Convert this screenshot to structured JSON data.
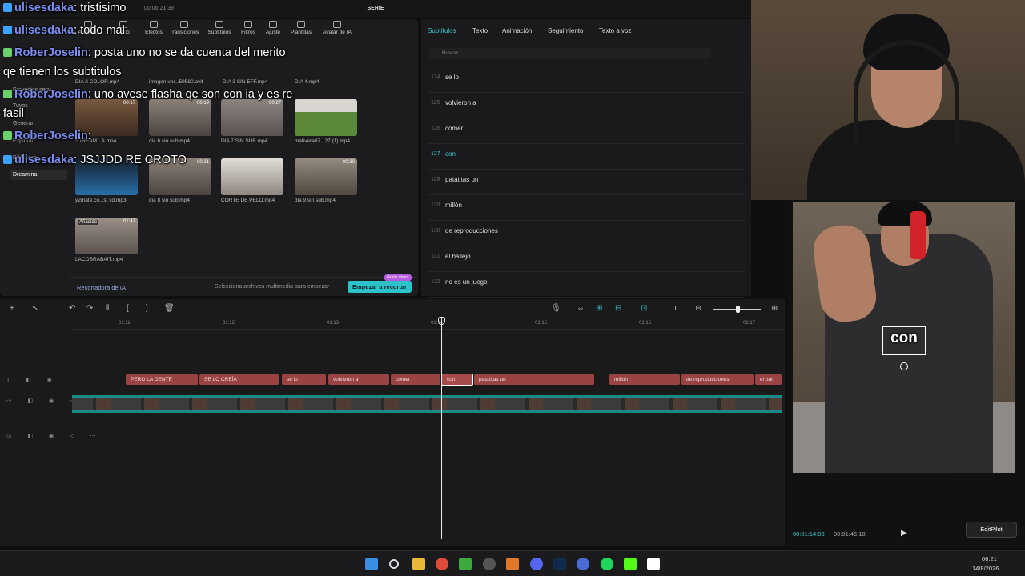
{
  "app": {
    "title": "SERIE",
    "timecode": "00:06:21:39"
  },
  "chat": [
    {
      "user": "ulisesdaka",
      "msg": ": tristisimo"
    },
    {
      "user": "ulisesdaka",
      "msg": ": todo mal"
    },
    {
      "user": "RoberJoselin",
      "msg": ": posta uno no se da cuenta del merito"
    },
    {
      "user": "",
      "msg": "qe tienen los subtitulos"
    },
    {
      "user": "RoberJoselin",
      "msg": ": uno avese flasha qe son con ia y es re"
    },
    {
      "user": "",
      "msg": "fasil"
    },
    {
      "user": "RoberJoselin",
      "msg": ":"
    },
    {
      "user": "ulisesdaka",
      "msg": ": JSJJDD RE CROTO"
    }
  ],
  "toolbar": [
    "Archivos",
    "Texto",
    "Efectos",
    "Transiciones",
    "Subtítulos",
    "Filtros",
    "Ajuste",
    "Plantillas",
    "Avatar de IA"
  ],
  "side_nav": [
    "Proyectos secu...",
    "Tuyos",
    "Generar",
    "Explorar",
    "Biblioteca",
    "Dreamina"
  ],
  "media": [
    {
      "name": "DIA 2 COLOR.mp4",
      "dur": ""
    },
    {
      "name": "imagen-ver...59580.avif",
      "dur": ""
    },
    {
      "name": "DIA 3 SIN EFF.mp4",
      "dur": ""
    },
    {
      "name": "DIA 4.mp4",
      "dur": ""
    },
    {
      "name": "STREAM...A.mp4",
      "dur": "00:17"
    },
    {
      "name": "dia 6 sin sub.mp4",
      "dur": "00:19"
    },
    {
      "name": "DIA 7 SIN SUB.mp4",
      "dur": "00:27"
    },
    {
      "name": "mativera07...27 (1).mp4",
      "dur": ""
    },
    {
      "name": "y2mate.co...st xd.mp3",
      "dur": ""
    },
    {
      "name": "dia 8 sin sub.mp4",
      "dur": "00:21"
    },
    {
      "name": "CORTE DE PELO.mp4",
      "dur": ""
    },
    {
      "name": "dia 9 sin sub.mp4",
      "dur": "00:30"
    },
    {
      "name": "LACOBRABAIT.mp4",
      "dur": "01:47",
      "added": "Añadido"
    }
  ],
  "media_footer": {
    "recorder": "Recortadora de IA",
    "hint": "Selecciona archivos multimedia para empezar",
    "start": "Empezar a recortar",
    "promo": "Gratis ahora"
  },
  "sub_tabs": [
    "Subtítulos",
    "Texto",
    "Animación",
    "Seguimiento",
    "Texto a voz"
  ],
  "search_placeholder": "Buscar",
  "subtitles": [
    {
      "n": "124",
      "t": "se lo"
    },
    {
      "n": "125",
      "t": "volvieron a"
    },
    {
      "n": "126",
      "t": "comer"
    },
    {
      "n": "127",
      "t": "con",
      "active": true
    },
    {
      "n": "128",
      "t": "patatitas un"
    },
    {
      "n": "129",
      "t": "millón"
    },
    {
      "n": "130",
      "t": "de reproducciones"
    },
    {
      "n": "131",
      "t": "el bailejo"
    },
    {
      "n": "132",
      "t": "no es un juego"
    }
  ],
  "preview": {
    "caption": "con",
    "current": "00:01:14:03",
    "total": "00:01:46:18",
    "editpilot": "EditPilot"
  },
  "ruler": [
    "01:11",
    "01:12",
    "01:13",
    "01:14",
    "01:15",
    "01:16",
    "01:17"
  ],
  "text_clips": [
    {
      "t": "PERO LA GENTE"
    },
    {
      "t": "SE LO CREÍA"
    },
    {
      "t": "se lo"
    },
    {
      "t": "volvieron a"
    },
    {
      "t": "comer"
    },
    {
      "t": "con",
      "active": true
    },
    {
      "t": "patatitas un"
    },
    {
      "t": "millón"
    },
    {
      "t": "de reproducciones"
    },
    {
      "t": "el bai"
    }
  ],
  "clock": {
    "time": "06:21",
    "date": "14/8/2026"
  },
  "colors": {
    "accent": "#38c8d0",
    "clip": "#9a4343",
    "username": "#7b8df0"
  }
}
